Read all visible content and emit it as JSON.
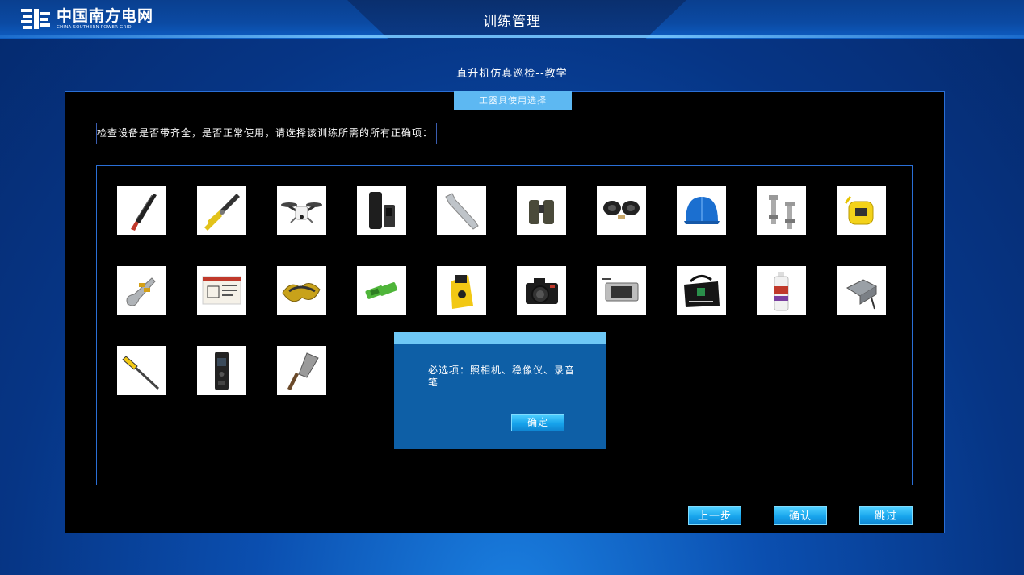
{
  "header": {
    "logo_cn": "中国南方电网",
    "logo_en": "CHINA SOUTHERN POWER GRID",
    "title": "训练管理"
  },
  "page": {
    "title": "直升机仿真巡检--教学",
    "tab_label": "工器具使用选择",
    "question": "检查设备是否带齐全，是否正常使用，请选择该训练所需的所有正确项："
  },
  "tools": [
    {
      "icon": "hacksaw-icon"
    },
    {
      "icon": "pliers-icon"
    },
    {
      "icon": "drone-icon"
    },
    {
      "icon": "case-icon"
    },
    {
      "icon": "wrench-icon"
    },
    {
      "icon": "binoculars-icon"
    },
    {
      "icon": "binoculars-black-icon"
    },
    {
      "icon": "helmet-icon"
    },
    {
      "icon": "bolts-icon"
    },
    {
      "icon": "tape-measure-icon"
    },
    {
      "icon": "clamp-icon"
    },
    {
      "icon": "calendar-icon"
    },
    {
      "icon": "rope-icon"
    },
    {
      "icon": "battery-icon"
    },
    {
      "icon": "rangefinder-icon"
    },
    {
      "icon": "camera-icon"
    },
    {
      "icon": "compact-camera-icon"
    },
    {
      "icon": "bag-icon"
    },
    {
      "icon": "spray-can-icon"
    },
    {
      "icon": "stabilizer-icon"
    },
    {
      "icon": "screwdriver-icon"
    },
    {
      "icon": "voice-recorder-icon"
    },
    {
      "icon": "scraper-icon"
    }
  ],
  "dialog": {
    "message": "必选项：照相机、稳像仪、录音笔",
    "ok_label": "确定"
  },
  "footer": {
    "prev_label": "上一步",
    "confirm_label": "确认",
    "skip_label": "跳过"
  },
  "colors": {
    "accent": "#17a4ec",
    "tab": "#5db8f2",
    "dialog": "#0e5fa6",
    "border": "#2a6fd6"
  }
}
